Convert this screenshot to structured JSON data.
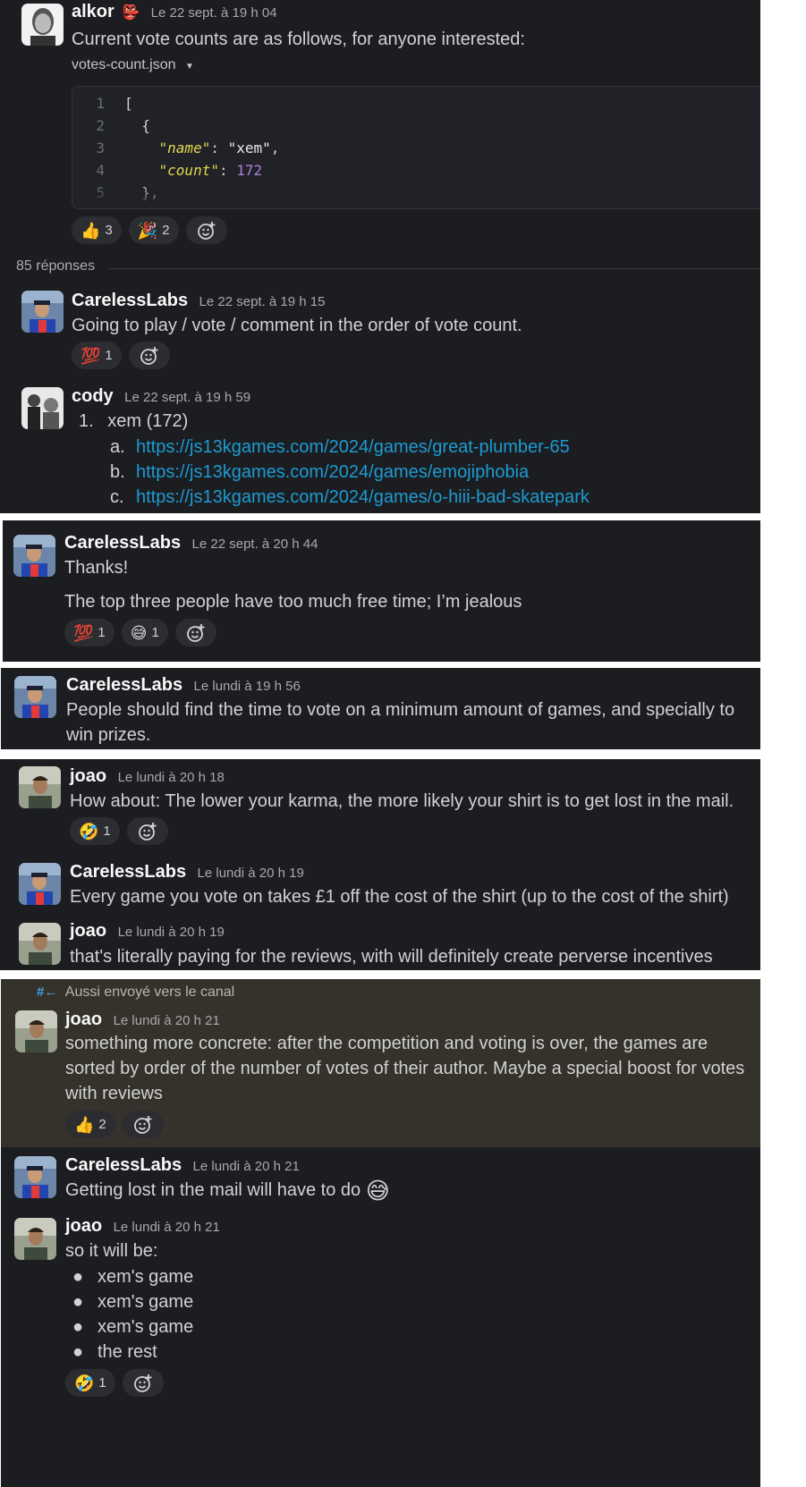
{
  "p1": {
    "alkor": {
      "username": "alkor",
      "status_emoji": "👺",
      "timestamp": "Le 22 sept. à 19 h 04",
      "text": "Current vote counts are as follows, for anyone interested:",
      "file_name": "votes-count.json",
      "code_lines": [
        {
          "n": "1",
          "text": "["
        },
        {
          "n": "2",
          "text": "  {"
        },
        {
          "n": "3",
          "key": "\"name\"",
          "sep": ": ",
          "val": "\"xem\"",
          "end": ","
        },
        {
          "n": "4",
          "key": "\"count\"",
          "sep": ": ",
          "num": "172"
        },
        {
          "n": "5",
          "text": "  },"
        }
      ],
      "reactions": [
        {
          "emoji": "👍",
          "count": "3"
        },
        {
          "emoji": "🎉",
          "count": "2"
        }
      ]
    },
    "replies_count": "85 réponses",
    "careless1": {
      "username": "CarelessLabs",
      "timestamp": "Le 22 sept. à 19 h 15",
      "text": "Going to play / vote / comment in the order of vote count.",
      "reactions": [
        {
          "emoji": "💯",
          "count": "1"
        }
      ]
    },
    "cody": {
      "username": "cody",
      "timestamp": "Le 22 sept. à 19 h 59",
      "list_marker": "1.",
      "list_item": "xem (172)",
      "sub_items": [
        {
          "marker": "a.",
          "link": "https://js13kgames.com/2024/games/great-plumber-65"
        },
        {
          "marker": "b.",
          "link": "https://js13kgames.com/2024/games/emojiphobia"
        },
        {
          "marker": "c.",
          "link": "https://js13kgames.com/2024/games/o-hiii-bad-skatepark"
        }
      ]
    }
  },
  "p2": {
    "username": "CarelessLabs",
    "timestamp": "Le 22 sept. à 20 h 44",
    "text1": "Thanks!",
    "text2": "The top three people have too much free time; I’m jealous",
    "reactions": [
      {
        "emoji": "💯",
        "count": "1"
      },
      {
        "emoji": "😅",
        "count": "1"
      }
    ]
  },
  "p3": {
    "username": "CarelessLabs",
    "timestamp": "Le lundi à 19 h 56",
    "text": "People should find the time to vote on a minimum amount of games, and specially to win prizes."
  },
  "p4": {
    "joao1": {
      "username": "joao",
      "timestamp": "Le lundi à 20 h 18",
      "text": "How about: The lower your karma, the more likely your shirt is to get lost in the mail.",
      "reactions": [
        {
          "emoji": "🤣",
          "count": "1"
        }
      ]
    },
    "careless": {
      "username": "CarelessLabs",
      "timestamp": "Le lundi à 20 h 19",
      "text": "Every game you vote on takes £1 off the cost of the shirt (up to the cost of the shirt)"
    },
    "joao2": {
      "username": "joao",
      "timestamp": "Le lundi à 20 h 19",
      "text": "that's literally paying for the reviews, with will definitely create perverse incentives"
    }
  },
  "p5": {
    "channel_note": "Aussi envoyé vers le canal",
    "joao": {
      "username": "joao",
      "timestamp": "Le lundi à 20 h 21",
      "text": "something more concrete: after the competition and voting is over, the games are sorted by order of the number of votes of their author. Maybe a special boost for votes with reviews",
      "reactions": [
        {
          "emoji": "👍",
          "count": "2"
        }
      ]
    },
    "careless": {
      "username": "CarelessLabs",
      "timestamp": "Le lundi à 20 h 21",
      "text": "Getting lost in the mail will have to do",
      "emoji": "😅"
    },
    "joao2": {
      "username": "joao",
      "timestamp": "Le lundi à 20 h 21",
      "text": "so it will be:",
      "bullets": [
        "xem's game",
        "xem's game",
        "xem's game",
        "the rest"
      ],
      "reactions": [
        {
          "emoji": "🤣",
          "count": "1"
        }
      ]
    }
  },
  "colors": {
    "background": "#1b1d21",
    "highlight": "#35322b",
    "link": "#1d9bd1",
    "code_key": "#e5d84e",
    "code_number": "#b07ee0"
  }
}
